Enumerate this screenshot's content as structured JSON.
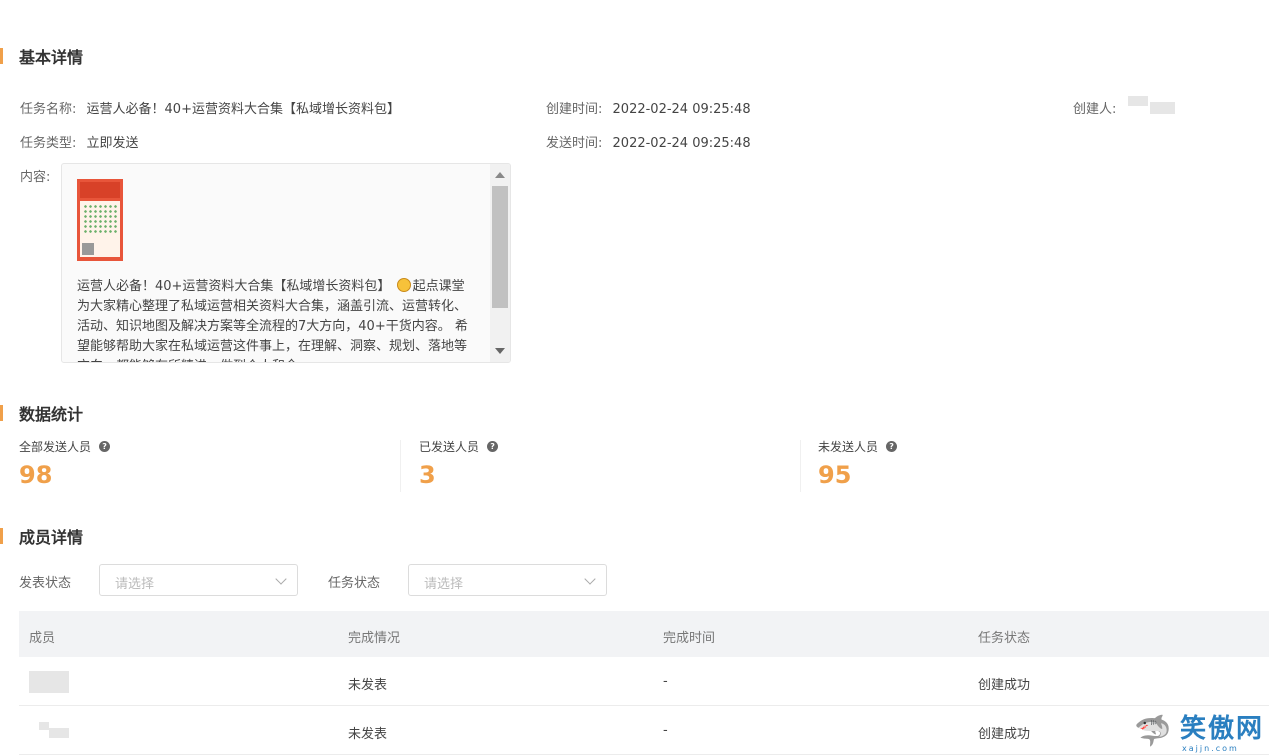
{
  "basic": {
    "title": "基本详情",
    "task_name_label": "任务名称:",
    "task_name": "运营人必备！40+运营资料大合集【私域增长资料包】",
    "created_time_label": "创建时间:",
    "created_time": "2022-02-24 09:25:48",
    "creator_label": "创建人:",
    "creator": "",
    "task_type_label": "任务类型:",
    "task_type": "立即发送",
    "send_time_label": "发送时间:",
    "send_time": "2022-02-24 09:25:48",
    "content_label": "内容:",
    "content_text_1": "运营人必备！40+运营资料大合集【私域增长资料包】",
    "content_text_2": "起点课堂为大家精心整理了私域运营相关资料大合集，涵盖引流、运营转化、活动、知识地图及解决方案等全流程的7大方向，40+干货内容。 希望能够帮助大家在私域运营这件事上，在理解、洞察、规划、落地等方向，都能够有所精进，做到个人和企"
  },
  "stats": {
    "title": "数据统计",
    "items": [
      {
        "label": "全部发送人员",
        "value": "98"
      },
      {
        "label": "已发送人员",
        "value": "3"
      },
      {
        "label": "未发送人员",
        "value": "95"
      }
    ],
    "help_icon": "?"
  },
  "members": {
    "title": "成员详情",
    "filters": [
      {
        "label": "发表状态",
        "placeholder": "请选择"
      },
      {
        "label": "任务状态",
        "placeholder": "请选择"
      }
    ],
    "columns": [
      "成员",
      "完成情况",
      "完成时间",
      "任务状态"
    ],
    "rows": [
      {
        "member": "",
        "completion": "未发表",
        "time": "-",
        "status": "创建成功"
      },
      {
        "member": "",
        "completion": "未发表",
        "time": "-",
        "status": "创建成功"
      }
    ]
  },
  "watermark": {
    "text": "笑傲网",
    "url": "xajjn.com"
  },
  "colors": {
    "accent": "#f0a04a",
    "header_bg": "#f2f3f5"
  }
}
